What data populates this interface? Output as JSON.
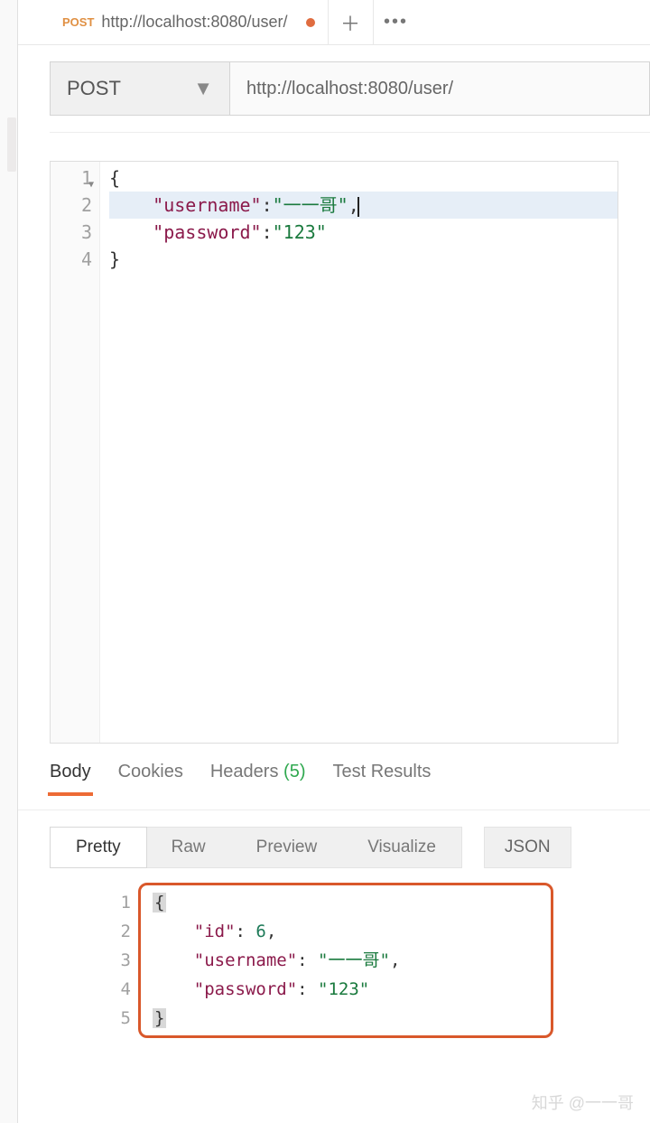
{
  "tab": {
    "method": "POST",
    "url": "http://localhost:8080/user/",
    "dirty": true
  },
  "request": {
    "method": "POST",
    "url": "http://localhost:8080/user/"
  },
  "editor": {
    "lines": [
      {
        "n": "1",
        "fold": true,
        "type": "brace",
        "text": "{"
      },
      {
        "n": "2",
        "type": "kv",
        "key": "\"username\"",
        "sep": ":",
        "val": "\"一一哥\"",
        "trail": ",",
        "cursor": true,
        "hl": true
      },
      {
        "n": "3",
        "type": "kv",
        "key": "\"password\"",
        "sep": ":",
        "val": "\"123\"",
        "trail": ""
      },
      {
        "n": "4",
        "type": "brace",
        "text": "}"
      }
    ]
  },
  "responseTabs": {
    "body": "Body",
    "cookies": "Cookies",
    "headers": "Headers",
    "headersCount": "(5)",
    "testResults": "Test Results"
  },
  "viewModes": {
    "pretty": "Pretty",
    "raw": "Raw",
    "preview": "Preview",
    "visualize": "Visualize",
    "format": "JSON"
  },
  "responseBody": {
    "lines": [
      {
        "n": "1",
        "type": "brace-sel",
        "text": "{"
      },
      {
        "n": "2",
        "type": "kv-num",
        "key": "\"id\"",
        "val": "6",
        "trail": ","
      },
      {
        "n": "3",
        "type": "kv-str",
        "key": "\"username\"",
        "val": "\"一一哥\"",
        "trail": ","
      },
      {
        "n": "4",
        "type": "kv-str",
        "key": "\"password\"",
        "val": "\"123\"",
        "trail": ""
      },
      {
        "n": "5",
        "type": "brace-sel",
        "text": "}"
      }
    ]
  },
  "watermark": "知乎 @一一哥"
}
